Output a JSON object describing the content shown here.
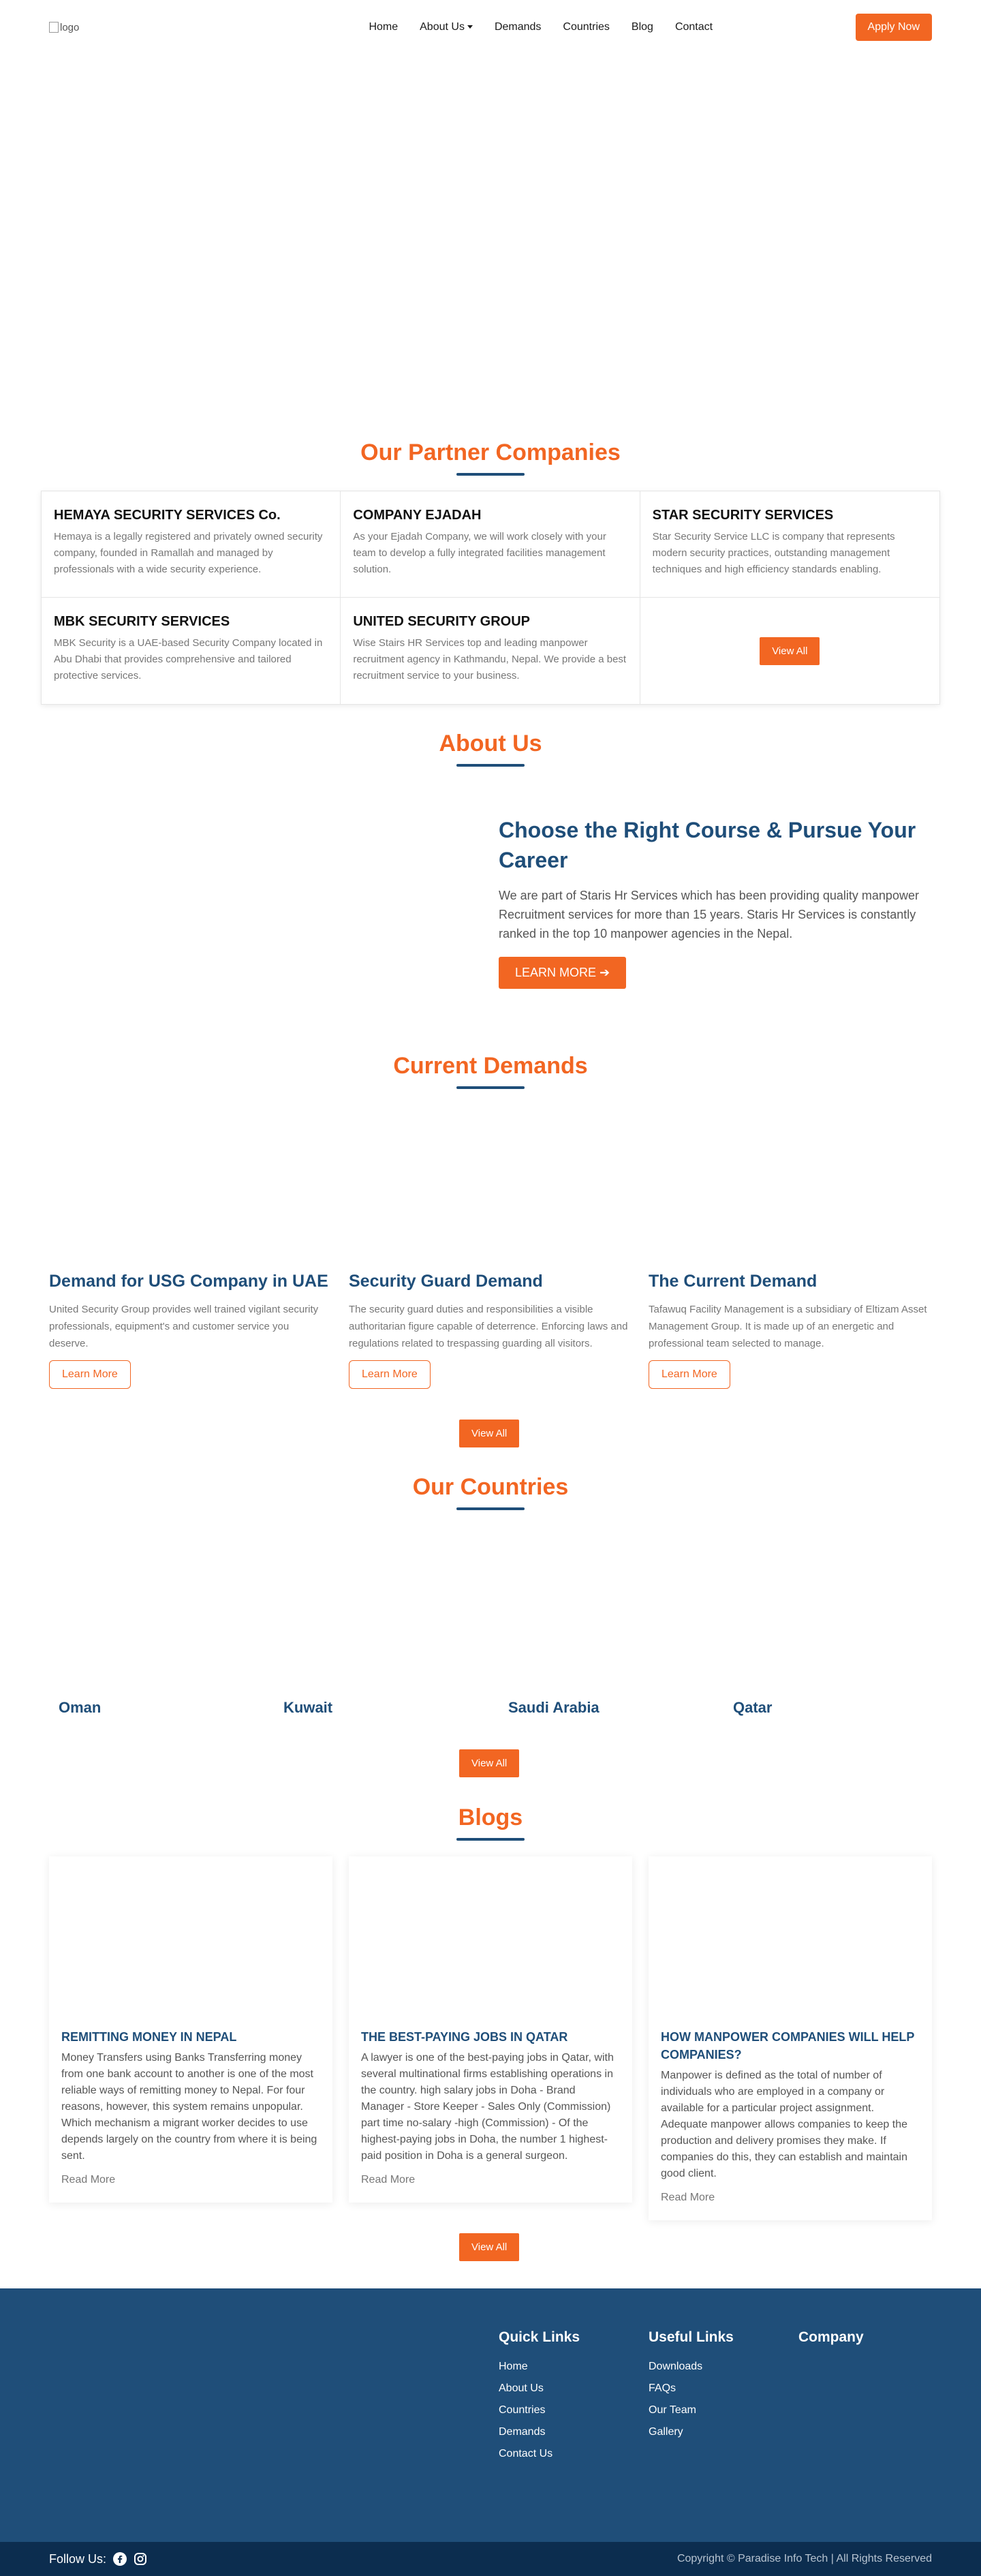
{
  "header": {
    "logo_alt": "logo",
    "nav": [
      "Home",
      "About Us",
      "Demands",
      "Countries",
      "Blog",
      "Contact"
    ],
    "apply_label": "Apply Now"
  },
  "partners": {
    "title": "Our Partner Companies",
    "items": [
      {
        "name": "HEMAYA SECURITY SERVICES Co.",
        "desc": "Hemaya is a legally registered and privately owned security company, founded in Ramallah and managed by professionals with a wide security experience."
      },
      {
        "name": "COMPANY EJADAH",
        "desc": "As your Ejadah Company, we will work closely with your team to develop a fully integrated facilities management solution."
      },
      {
        "name": "STAR SECURITY SERVICES",
        "desc": "Star Security Service LLC is company that represents modern security practices, outstanding management techniques and high efficiency standards enabling."
      },
      {
        "name": "MBK SECURITY SERVICES",
        "desc": "MBK Security is a UAE-based Security Company located in Abu Dhabi that provides comprehensive and tailored protective services."
      },
      {
        "name": "UNITED SECURITY GROUP",
        "desc": "Wise Stairs HR Services top and leading manpower recruitment agency in Kathmandu, Nepal. We provide a best recruitment service to your business."
      }
    ],
    "view_all": "View All"
  },
  "about": {
    "title": "About Us",
    "heading": "Choose the Right Course & Pursue Your Career",
    "text": "We are part of Staris Hr Services which has been providing quality manpower Recruitment services for more than 15 years. Staris Hr Services is constantly ranked in the top 10 manpower agencies in the Nepal.",
    "button": "LEARN MORE"
  },
  "demands": {
    "title": "Current Demands",
    "items": [
      {
        "title": "Demand for USG Company in UAE",
        "desc": "United Security Group provides well trained vigilant security professionals, equipment's and customer service you deserve.",
        "button": "Learn More"
      },
      {
        "title": "Security Guard Demand",
        "desc": "The security guard duties and responsibilities a visible authoritarian figure capable of deterrence. Enforcing laws and regulations related to trespassing guarding all visitors.",
        "button": "Learn More"
      },
      {
        "title": "The Current Demand",
        "desc": "Tafawuq Facility Management is a subsidiary of Eltizam Asset Management Group. It is made up of an energetic and professional team selected to manage.",
        "button": "Learn More"
      }
    ],
    "view_all": "View All"
  },
  "countries": {
    "title": "Our Countries",
    "items": [
      "Oman",
      "Kuwait",
      "Saudi Arabia",
      "Qatar"
    ],
    "view_all": "View All"
  },
  "blogs": {
    "title": "Blogs",
    "items": [
      {
        "title": "REMITTING MONEY IN NEPAL",
        "desc": "Money Transfers using Banks Transferring money from one bank account to another is one of the most reliable ways of remitting money to Nepal. For four reasons, however, this system remains unpopular. Which mechanism a migrant worker decides to use depends largely on the country from where it is being sent.",
        "more": "Read More"
      },
      {
        "title": "THE BEST-PAYING JOBS IN QATAR",
        "desc": "A lawyer is one of the best-paying jobs in Qatar, with several multinational firms establishing operations in the country. high salary jobs in Doha - Brand Manager - Store Keeper - Sales Only (Commission) part time no-salary -high (Commission) - Of the highest-paying jobs in Doha, the number 1 highest-paid position in Doha is a general surgeon.",
        "more": "Read More"
      },
      {
        "title": "HOW MANPOWER COMPANIES WILL HELP COMPANIES?",
        "desc": "Manpower is defined as the total of number of individuals who are employed in a company or available for a particular project assignment. Adequate manpower allows companies to keep the production and delivery promises they make. If companies do this, they can establish and maintain good client.",
        "more": "Read More"
      }
    ],
    "view_all": "View All"
  },
  "footer": {
    "quick_title": "Quick Links",
    "quick": [
      "Home",
      "About Us",
      "Countries",
      "Demands",
      "Contact Us"
    ],
    "useful_title": "Useful Links",
    "useful": [
      "Downloads",
      "FAQs",
      "Our Team",
      "Gallery"
    ],
    "company_title": "Company",
    "follow": "Follow Us:",
    "copyright": "Copyright © Paradise Info Tech | All Rights Reserved"
  },
  "colors": {
    "accent": "#f26622",
    "brand": "#1f4e79",
    "footer_bottom": "#0c2d4f"
  }
}
